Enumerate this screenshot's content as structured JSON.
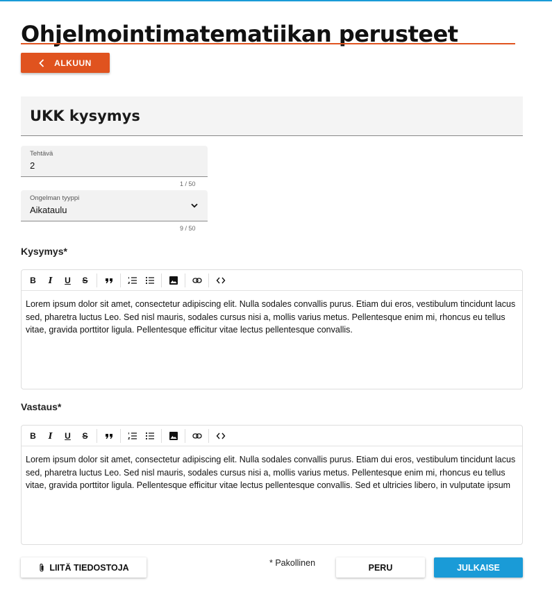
{
  "page": {
    "title": "Ohjelmointimatematiikan perusteet",
    "back_label": "ALKUUN"
  },
  "section": {
    "title": "UKK kysymys"
  },
  "fields": {
    "task": {
      "label": "Tehtävä",
      "value": "2",
      "counter": "1 / 50"
    },
    "problem_type": {
      "label": "Ongelman tyyppi",
      "value": "Aikataulu",
      "counter": "9 / 50"
    }
  },
  "question": {
    "label": "Kysymys*",
    "text": "Lorem ipsum dolor sit amet, consectetur adipiscing elit. Nulla sodales convallis purus. Etiam dui eros, vestibulum tincidunt lacus sed, pharetra luctus Leo. Sed nisl mauris, sodales cursus nisi a, mollis varius metus. Pellentesque enim mi, rhoncus eu tellus vitae, gravida porttitor ligula. Pellentesque efficitur vitae lectus pellentesque convallis."
  },
  "answer": {
    "label": "Vastaus*",
    "text": "Lorem ipsum dolor sit amet, consectetur adipiscing elit. Nulla sodales convallis purus. Etiam dui eros, vestibulum tincidunt lacus sed, pharetra luctus Leo. Sed nisl mauris, sodales cursus nisi a, mollis varius metus. Pellentesque enim mi, rhoncus eu tellus vitae, gravida porttitor ligula. Pellentesque efficitur vitae lectus pellentesque convallis. Sed et ultricies libero, in vulputate ipsum"
  },
  "toolbar": {
    "bold": "B",
    "italic": "I",
    "underline": "U",
    "strike": "S",
    "icons": [
      "bold-icon",
      "italic-icon",
      "underline-icon",
      "strikethrough-icon",
      "blockquote-icon",
      "ordered-list-icon",
      "bullet-list-icon",
      "image-icon",
      "link-icon",
      "code-icon"
    ]
  },
  "footer": {
    "attach_label": "LIITÄ TIEDOSTOJA",
    "required_note": "*  Pakollinen",
    "cancel_label": "PERU",
    "publish_label": "JULKAISE"
  },
  "colors": {
    "accent_orange": "#e0531f",
    "accent_blue": "#1a9bd7"
  }
}
